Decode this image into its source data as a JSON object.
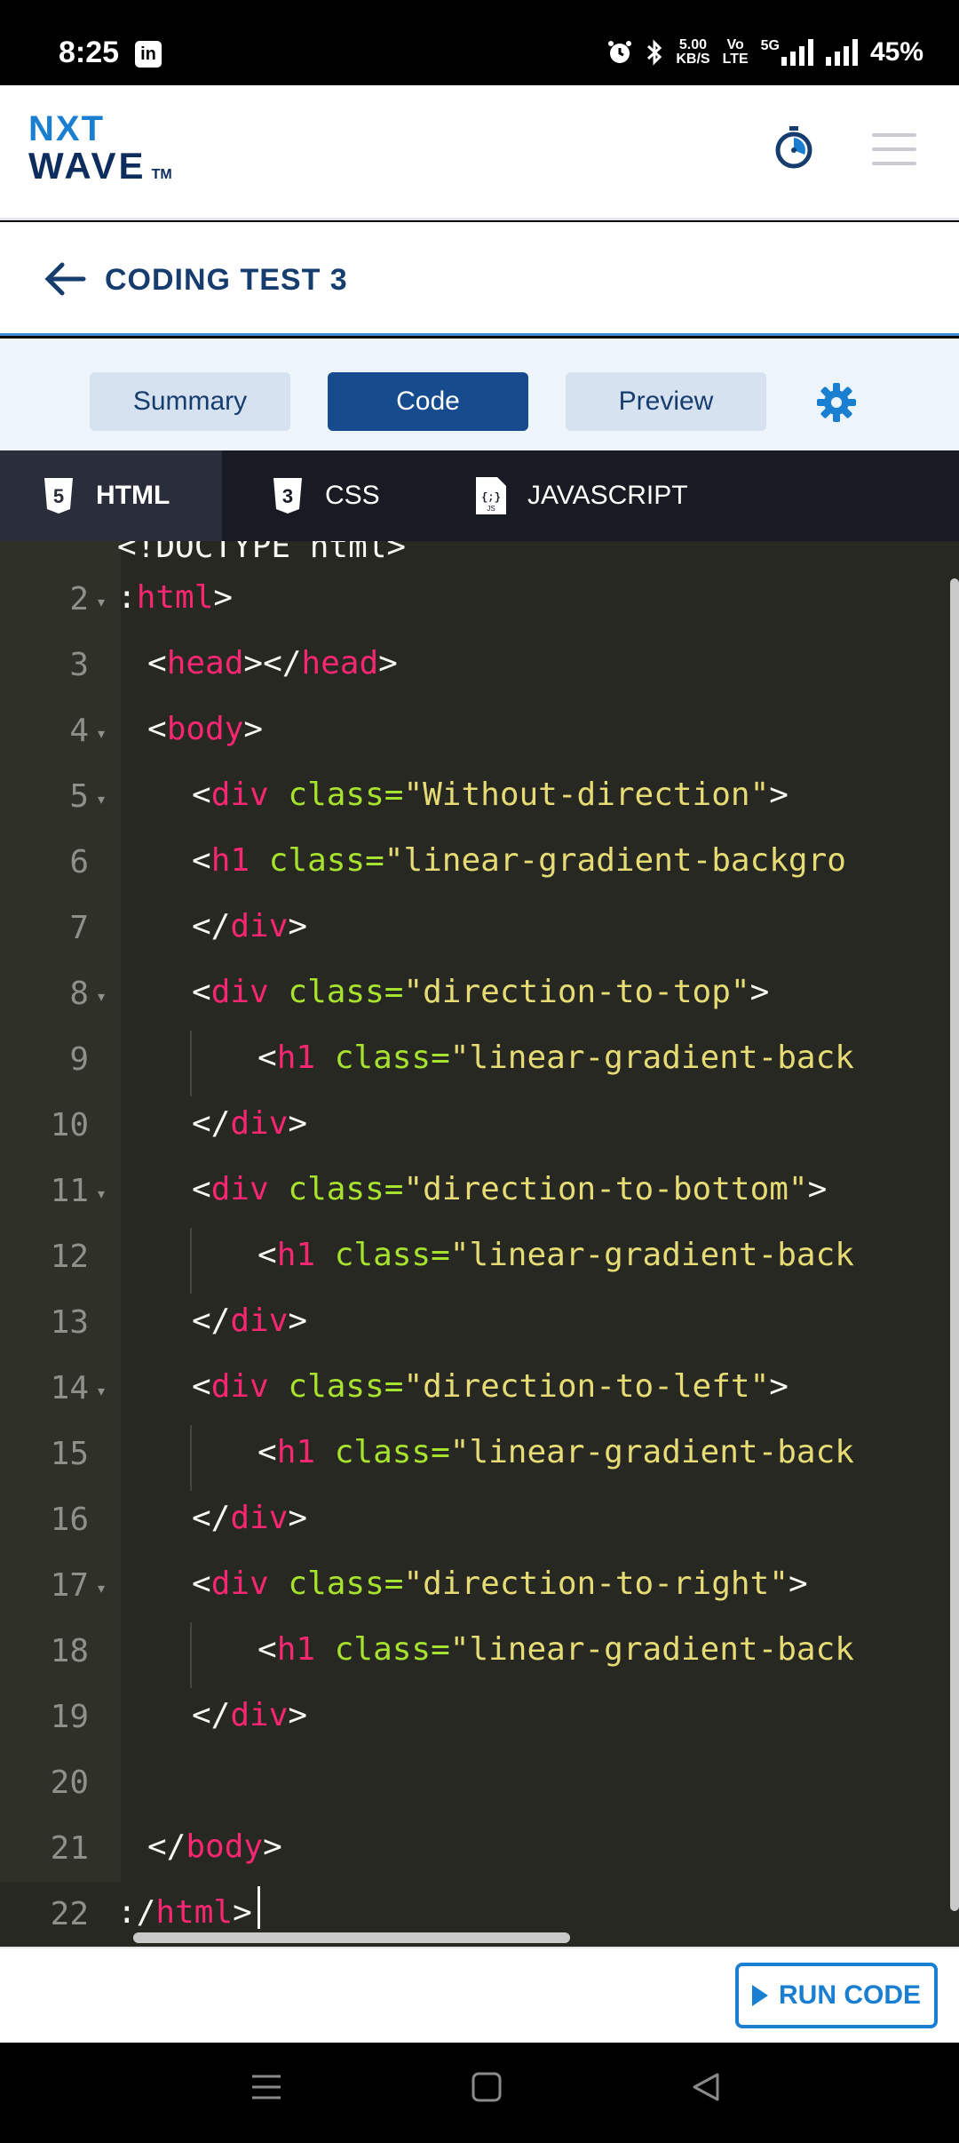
{
  "status_bar": {
    "time": "8:25",
    "linkedin_glyph": "in",
    "net_speed_value": "5.00",
    "net_speed_unit": "KB/S",
    "volte_top": "Vo",
    "volte_bottom": "LTE",
    "network": "5G",
    "battery": "45%",
    "icons": [
      "alarm-icon",
      "bluetooth-icon",
      "signal-icon",
      "signal-icon"
    ]
  },
  "header": {
    "logo_top": "NXT",
    "logo_bottom": "WAVE",
    "logo_tm": "TM",
    "colors": {
      "logo_blue": "#1a7fd1",
      "logo_navy": "#0d2d5e"
    }
  },
  "title_row": {
    "title": "CODING TEST 3"
  },
  "view_tabs": {
    "summary": "Summary",
    "code": "Code",
    "preview": "Preview",
    "active": "Code",
    "colors": {
      "active": "#164b8e",
      "inactive": "#d7e2f1"
    }
  },
  "editor_tabs": {
    "html": "HTML",
    "css": "CSS",
    "javascript": "JAVASCRIPT",
    "active": "HTML"
  },
  "editor": {
    "line_numbers": [
      "2",
      "3",
      "4",
      "5",
      "6",
      "7",
      "8",
      "9",
      "10",
      "11",
      "12",
      "13",
      "14",
      "15",
      "16",
      "17",
      "18",
      "19",
      "20",
      "21",
      "22"
    ],
    "lines": [
      {
        "prefix": ":",
        "tag": "html",
        "suffix": ">"
      },
      {
        "l1": "<",
        "t1": "head",
        "l2": "></",
        "t2": "head",
        "l3": ">"
      },
      {
        "l1": "<",
        "t1": "body",
        "l2": ">"
      },
      {
        "l1": "<",
        "t1": "div",
        "attr": "class=",
        "val": "\"Without-direction\"",
        "l2": ">"
      },
      {
        "l1": "<",
        "t1": "h1",
        "attr": "class=",
        "val": "\"linear-gradient-backgro"
      },
      {
        "l1": "</",
        "t1": "div",
        "l2": ">"
      },
      {
        "l1": "<",
        "t1": "div",
        "attr": "class=",
        "val": "\"direction-to-top\"",
        "l2": ">"
      },
      {
        "l1": "<",
        "t1": "h1",
        "attr": "class=",
        "val": "\"linear-gradient-back"
      },
      {
        "l1": "</",
        "t1": "div",
        "l2": ">"
      },
      {
        "l1": "<",
        "t1": "div",
        "attr": "class=",
        "val": "\"direction-to-bottom\"",
        "l2": ">"
      },
      {
        "l1": "<",
        "t1": "h1",
        "attr": "class=",
        "val": "\"linear-gradient-back"
      },
      {
        "l1": "</",
        "t1": "div",
        "l2": ">"
      },
      {
        "l1": "<",
        "t1": "div",
        "attr": "class=",
        "val": "\"direction-to-left\"",
        "l2": ">"
      },
      {
        "l1": "<",
        "t1": "h1",
        "attr": "class=",
        "val": "\"linear-gradient-back"
      },
      {
        "l1": "</",
        "t1": "div",
        "l2": ">"
      },
      {
        "l1": "<",
        "t1": "div",
        "attr": "class=",
        "val": "\"direction-to-right\"",
        "l2": ">"
      },
      {
        "l1": "<",
        "t1": "h1",
        "attr": "class=",
        "val": "\"linear-gradient-back"
      },
      {
        "l1": "</",
        "t1": "div",
        "l2": ">"
      },
      {},
      {
        "l1": "</",
        "t1": "body",
        "l2": ">"
      },
      {
        "prefix": ":/",
        "tag": "html",
        "suffix": ">"
      }
    ],
    "colors": {
      "background": "#272822",
      "tag": "#f92672",
      "attribute": "#a6e22e",
      "string": "#e6db74"
    }
  },
  "footer": {
    "run_label": "RUN CODE"
  },
  "navbar": {
    "icons": [
      "menu-nav-icon",
      "home-square-icon",
      "back-triangle-icon"
    ]
  }
}
